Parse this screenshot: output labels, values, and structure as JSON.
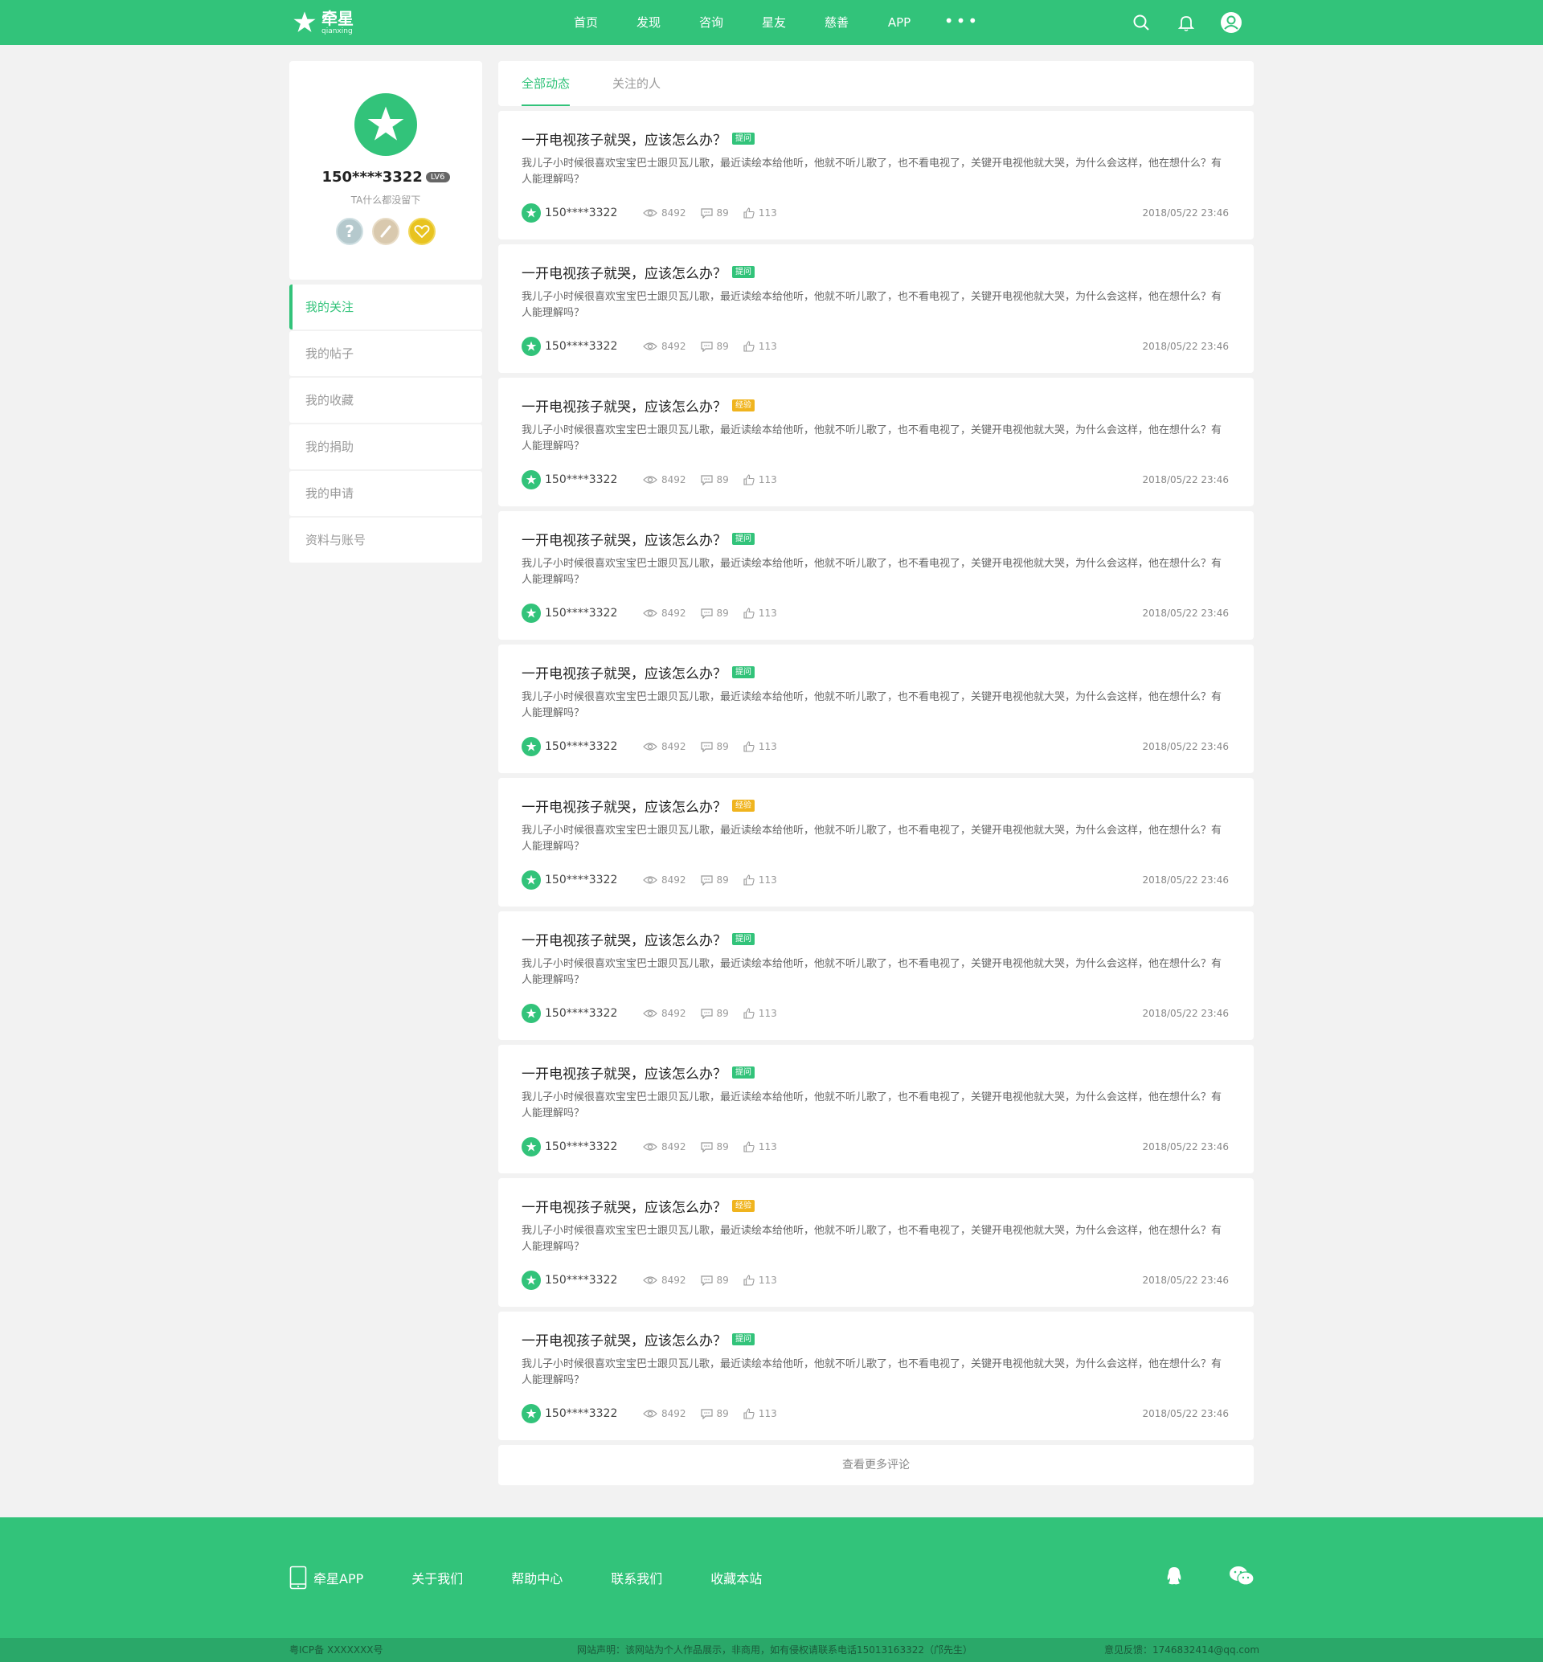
{
  "header": {
    "logo_cn": "牵星",
    "logo_en": "qianxing",
    "nav": [
      "首页",
      "发现",
      "咨询",
      "星友",
      "慈善",
      "APP"
    ],
    "more": "•••"
  },
  "profile": {
    "username": "150****3322",
    "level": "LV6",
    "signature": "TA什么都没留下"
  },
  "menu": [
    "我的关注",
    "我的帖子",
    "我的收藏",
    "我的捐助",
    "我的申请",
    "资料与账号"
  ],
  "tabs": [
    "全部动态",
    "关注的人"
  ],
  "colors": {
    "accent": "#32c37a",
    "tag_question": "#32c37a",
    "tag_experience": "#f0b41e"
  },
  "posts": [
    {
      "title": "一开电视孩子就哭，应该怎么办？",
      "tag": "提问",
      "tag_type": "question",
      "body": "我儿子小时候很喜欢宝宝巴士跟贝瓦儿歌，最近读绘本给他听，他就不听儿歌了，也不看电视了，关键开电视他就大哭，为什么会这样，他在想什么？有人能理解吗？",
      "author": "150****3322",
      "views": "8492",
      "comments": "89",
      "likes": "113",
      "time": "2018/05/22  23:46"
    },
    {
      "title": "一开电视孩子就哭，应该怎么办？",
      "tag": "提问",
      "tag_type": "question",
      "body": "我儿子小时候很喜欢宝宝巴士跟贝瓦儿歌，最近读绘本给他听，他就不听儿歌了，也不看电视了，关键开电视他就大哭，为什么会这样，他在想什么？有人能理解吗？",
      "author": "150****3322",
      "views": "8492",
      "comments": "89",
      "likes": "113",
      "time": "2018/05/22  23:46"
    },
    {
      "title": "一开电视孩子就哭，应该怎么办？",
      "tag": "经验",
      "tag_type": "experience",
      "body": "我儿子小时候很喜欢宝宝巴士跟贝瓦儿歌，最近读绘本给他听，他就不听儿歌了，也不看电视了，关键开电视他就大哭，为什么会这样，他在想什么？有人能理解吗？",
      "author": "150****3322",
      "views": "8492",
      "comments": "89",
      "likes": "113",
      "time": "2018/05/22  23:46"
    },
    {
      "title": "一开电视孩子就哭，应该怎么办？",
      "tag": "提问",
      "tag_type": "question",
      "body": "我儿子小时候很喜欢宝宝巴士跟贝瓦儿歌，最近读绘本给他听，他就不听儿歌了，也不看电视了，关键开电视他就大哭，为什么会这样，他在想什么？有人能理解吗？",
      "author": "150****3322",
      "views": "8492",
      "comments": "89",
      "likes": "113",
      "time": "2018/05/22  23:46"
    },
    {
      "title": "一开电视孩子就哭，应该怎么办？",
      "tag": "提问",
      "tag_type": "question",
      "body": "我儿子小时候很喜欢宝宝巴士跟贝瓦儿歌，最近读绘本给他听，他就不听儿歌了，也不看电视了，关键开电视他就大哭，为什么会这样，他在想什么？有人能理解吗？",
      "author": "150****3322",
      "views": "8492",
      "comments": "89",
      "likes": "113",
      "time": "2018/05/22  23:46"
    },
    {
      "title": "一开电视孩子就哭，应该怎么办？",
      "tag": "经验",
      "tag_type": "experience",
      "body": "我儿子小时候很喜欢宝宝巴士跟贝瓦儿歌，最近读绘本给他听，他就不听儿歌了，也不看电视了，关键开电视他就大哭，为什么会这样，他在想什么？有人能理解吗？",
      "author": "150****3322",
      "views": "8492",
      "comments": "89",
      "likes": "113",
      "time": "2018/05/22  23:46"
    },
    {
      "title": "一开电视孩子就哭，应该怎么办？",
      "tag": "提问",
      "tag_type": "question",
      "body": "我儿子小时候很喜欢宝宝巴士跟贝瓦儿歌，最近读绘本给他听，他就不听儿歌了，也不看电视了，关键开电视他就大哭，为什么会这样，他在想什么？有人能理解吗？",
      "author": "150****3322",
      "views": "8492",
      "comments": "89",
      "likes": "113",
      "time": "2018/05/22  23:46"
    },
    {
      "title": "一开电视孩子就哭，应该怎么办？",
      "tag": "提问",
      "tag_type": "question",
      "body": "我儿子小时候很喜欢宝宝巴士跟贝瓦儿歌，最近读绘本给他听，他就不听儿歌了，也不看电视了，关键开电视他就大哭，为什么会这样，他在想什么？有人能理解吗？",
      "author": "150****3322",
      "views": "8492",
      "comments": "89",
      "likes": "113",
      "time": "2018/05/22  23:46"
    },
    {
      "title": "一开电视孩子就哭，应该怎么办？",
      "tag": "经验",
      "tag_type": "experience",
      "body": "我儿子小时候很喜欢宝宝巴士跟贝瓦儿歌，最近读绘本给他听，他就不听儿歌了，也不看电视了，关键开电视他就大哭，为什么会这样，他在想什么？有人能理解吗？",
      "author": "150****3322",
      "views": "8492",
      "comments": "89",
      "likes": "113",
      "time": "2018/05/22  23:46"
    },
    {
      "title": "一开电视孩子就哭，应该怎么办？",
      "tag": "提问",
      "tag_type": "question",
      "body": "我儿子小时候很喜欢宝宝巴士跟贝瓦儿歌，最近读绘本给他听，他就不听儿歌了，也不看电视了，关键开电视他就大哭，为什么会这样，他在想什么？有人能理解吗？",
      "author": "150****3322",
      "views": "8492",
      "comments": "89",
      "likes": "113",
      "time": "2018/05/22  23:46"
    }
  ],
  "load_more": "查看更多评论",
  "footer": {
    "links": [
      "牵星APP",
      "关于我们",
      "帮助中心",
      "联系我们",
      "收藏本站"
    ],
    "icp": "粤ICP备 XXXXXXX号",
    "statement": "网站声明：该网站为个人作品展示，非商用，如有侵权请联系电话15013163322（邝先生）",
    "feedback": "意见反馈：1746832414@qq.com"
  }
}
